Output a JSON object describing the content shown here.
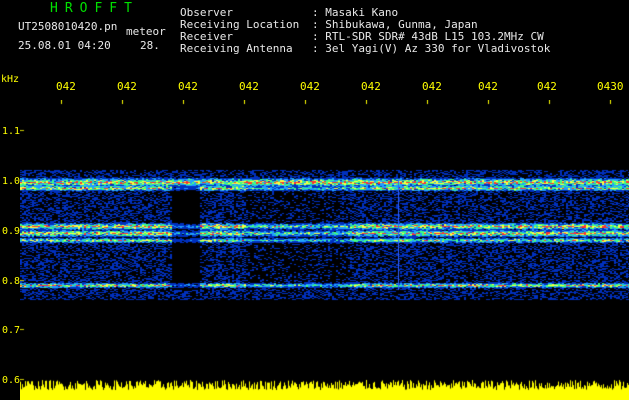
{
  "header": {
    "title": "HROFFT",
    "file_name": "UT2508010420.pn",
    "mode": "meteor",
    "datetime": "25.08.01 04:20",
    "frame": "28."
  },
  "info": [
    {
      "key": "Observer",
      "value": ": Masaki Kano"
    },
    {
      "key": "Receiving Location",
      "value": ": Shibukawa, Gunma, Japan"
    },
    {
      "key": "Receiver",
      "value": ": RTL-SDR SDR# 43dB L15 103.2MHz CW"
    },
    {
      "key": "Receiving Antenna",
      "value": ": 3el Yagi(V) Az 330 for Vladivostok"
    }
  ],
  "axis": {
    "unit": "kHz",
    "freq_labels": [
      "1.1",
      "1.0",
      "0.9",
      "0.8",
      "0.7",
      "0.6"
    ],
    "time_labels": [
      "042",
      "042",
      "042",
      "042",
      "042",
      "042",
      "042",
      "042",
      "042",
      "0430"
    ]
  },
  "colors": {
    "background": "#000000",
    "title": "#00e000",
    "text": "#e8e8e8",
    "axis": "#ffff00"
  }
}
